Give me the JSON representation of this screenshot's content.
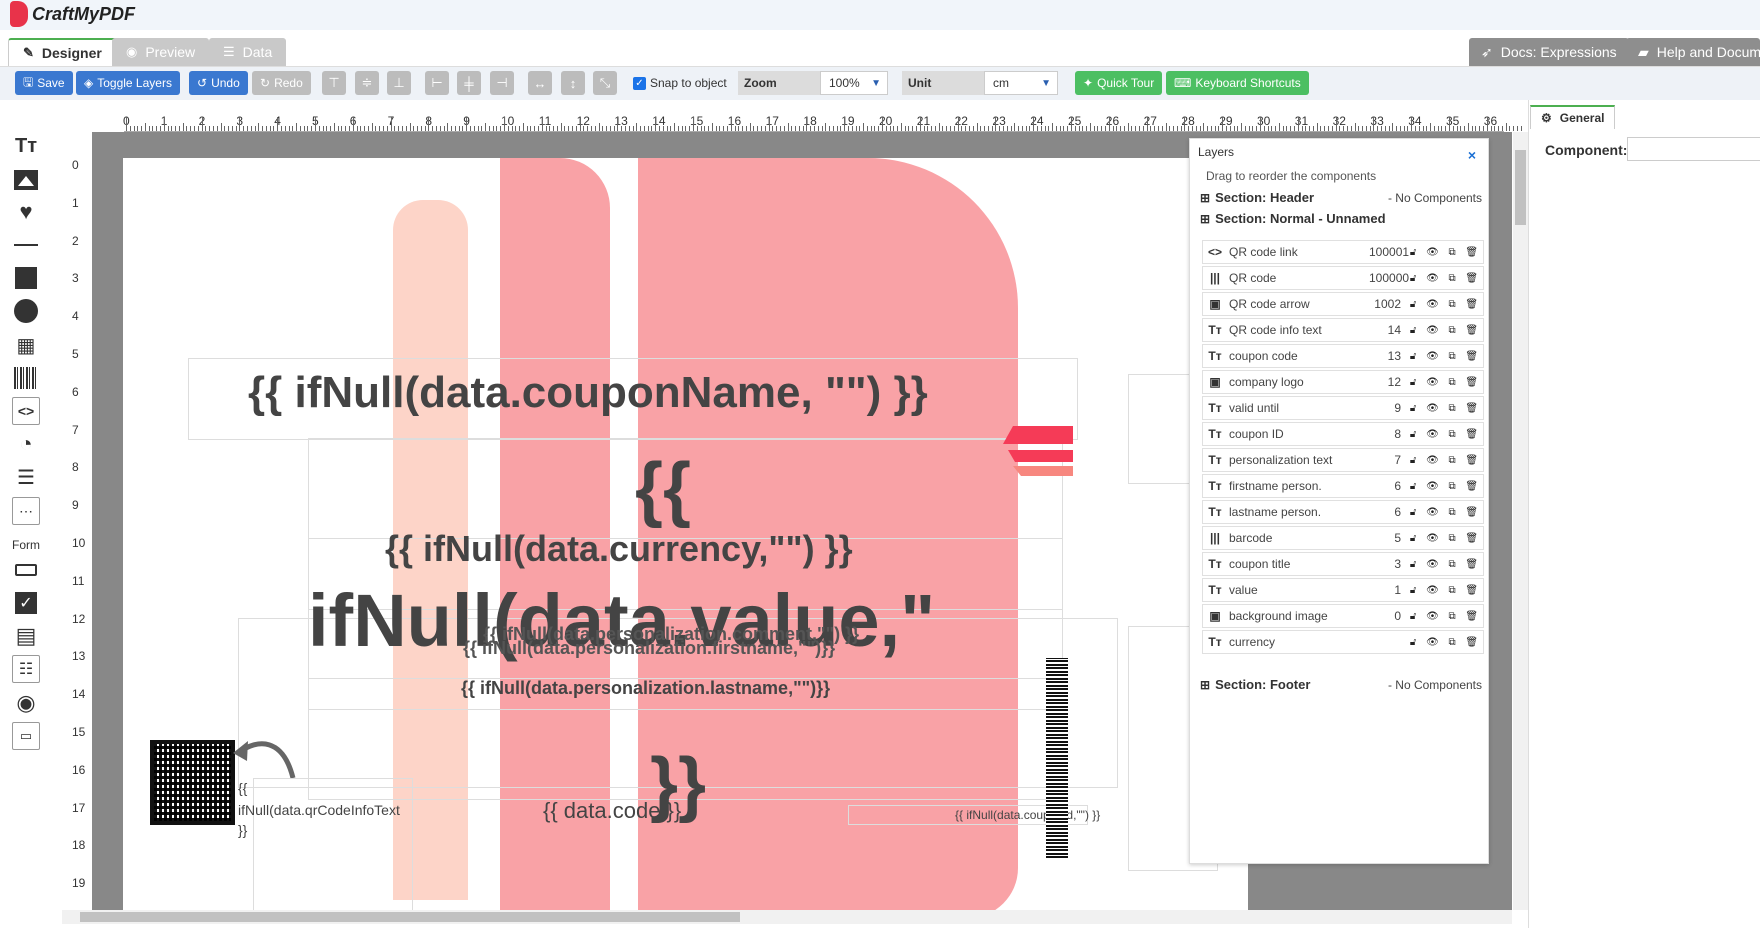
{
  "app": {
    "logo_text": "CraftMyPDF"
  },
  "tabs": [
    {
      "label": "Designer",
      "icon": "pencil-icon"
    },
    {
      "label": "Preview",
      "icon": "eye-icon"
    },
    {
      "label": "Data",
      "icon": "database-icon"
    }
  ],
  "help_tabs": [
    {
      "label": "Docs: Expressions",
      "icon": "rocket-icon"
    },
    {
      "label": "Help and Docum",
      "icon": "book-icon"
    }
  ],
  "toolbar": {
    "save": "Save",
    "toggle_layers": "Toggle Layers",
    "undo": "Undo",
    "redo": "Redo",
    "snap_label": "Snap to object",
    "snap_checked": true,
    "zoom_label": "Zoom",
    "zoom_value": "100%",
    "unit_label": "Unit",
    "unit_value": "cm",
    "quick_tour": "Quick Tour",
    "keyboard_shortcuts": "Keyboard Shortcuts"
  },
  "palette": {
    "form_label": "Form",
    "tools": [
      "text-tool-icon",
      "image-tool-icon",
      "heart-shape-icon",
      "line-tool-icon",
      "rectangle-tool-icon",
      "circle-tool-icon",
      "qrcode-tool-icon",
      "barcode-tool-icon",
      "html-tool-icon",
      "chart-tool-icon",
      "table-tool-icon",
      "container-tool-icon"
    ],
    "form_tools": [
      "textfield-tool-icon",
      "checkbox-tool-icon",
      "combobox-tool-icon",
      "listbox-tool-icon",
      "radio-tool-icon",
      "signature-tool-icon"
    ]
  },
  "ruler": {
    "h": [
      "0",
      "1",
      "2",
      "3",
      "4",
      "5",
      "6",
      "7",
      "8",
      "9",
      "10",
      "11",
      "12",
      "13",
      "14",
      "15",
      "16",
      "17",
      "18",
      "19",
      "20",
      "21",
      "22",
      "23",
      "24",
      "25",
      "26",
      "27",
      "28",
      "29",
      "30",
      "31",
      "32",
      "33",
      "34",
      "35",
      "36"
    ],
    "v": [
      "0",
      "1",
      "2",
      "3",
      "4",
      "5",
      "6",
      "7",
      "8",
      "9",
      "10",
      "11",
      "12",
      "13",
      "14",
      "15",
      "16",
      "17",
      "18",
      "19"
    ]
  },
  "canvas": {
    "coupon_name": "{{ ifNull(data.couponName, \"\") }}",
    "value_open": "{{",
    "currency": "{{ ifNull(data.currency,\"\") }}",
    "value_expr": "ifNull(data.value,\"",
    "personalization_overlap": "{{ ifNull(data.personalization.comment,\"\") }}",
    "personalization_firstname": "{{ ifNull(data.personalization.firstname,\"\")}}",
    "personalization_lastname": "{{ ifNull(data.personalization.lastname,\"\")}}",
    "value_close": "}}",
    "qr_info_open": "{{",
    "qr_info_expr": "ifNull(data.qrCodeInfoText",
    "qr_info_close": "}}",
    "code": "{{ data.code }}",
    "coupon_id": "{{ ifNull(data.couponId,\"\") }}"
  },
  "layers": {
    "title": "Layers",
    "hint": "Drag to reorder the components",
    "sections": {
      "header": {
        "name": "Section: Header",
        "status": "- No Components"
      },
      "normal": {
        "name": "Section: Normal - Unnamed"
      },
      "footer": {
        "name": "Section: Footer",
        "status": "- No Components"
      }
    },
    "items": [
      {
        "name": "QR code link",
        "id": "100001",
        "icon": "html-icon"
      },
      {
        "name": "QR code",
        "id": "100000",
        "icon": "barcode-icon"
      },
      {
        "name": "QR code arrow",
        "id": "1002",
        "icon": "image-icon"
      },
      {
        "name": "QR code info text",
        "id": "14",
        "icon": "text-icon"
      },
      {
        "name": "coupon code",
        "id": "13",
        "icon": "text-icon"
      },
      {
        "name": "company logo",
        "id": "12",
        "icon": "image-icon"
      },
      {
        "name": "valid until",
        "id": "9",
        "icon": "text-icon"
      },
      {
        "name": "coupon ID",
        "id": "8",
        "icon": "text-icon"
      },
      {
        "name": "personalization text",
        "id": "7",
        "icon": "text-icon"
      },
      {
        "name": "firstname person.",
        "id": "6",
        "icon": "text-icon"
      },
      {
        "name": "lastname person.",
        "id": "6",
        "icon": "text-icon"
      },
      {
        "name": "barcode",
        "id": "5",
        "icon": "barcode-icon"
      },
      {
        "name": "coupon title",
        "id": "3",
        "icon": "text-icon"
      },
      {
        "name": "value",
        "id": "1",
        "icon": "text-icon"
      },
      {
        "name": "background image",
        "id": "0",
        "icon": "image-icon"
      },
      {
        "name": "currency",
        "id": "",
        "icon": "text-icon"
      }
    ]
  },
  "properties": {
    "tab": "General",
    "component_label": "Component:",
    "component_value": ""
  }
}
